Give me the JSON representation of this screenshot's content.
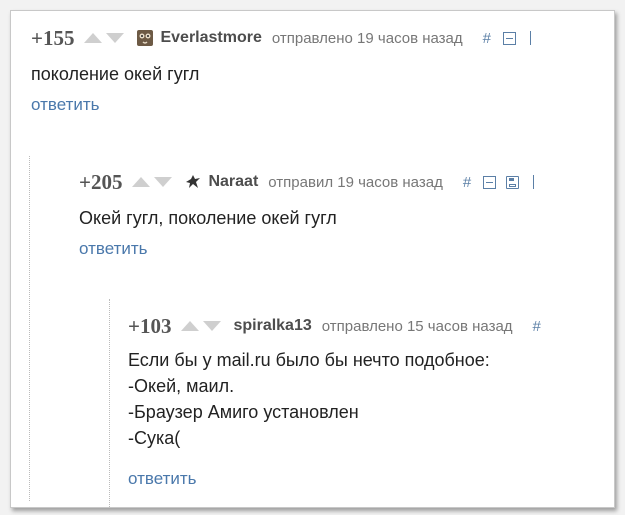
{
  "comments": [
    {
      "rating": "+155",
      "author": "Everlastmore",
      "time": "отправлено 19 часов назад",
      "lines": [
        "поколение окей гугл"
      ],
      "reply": "ответить",
      "avatar_icon": "owl-avatar-icon"
    },
    {
      "rating": "+205",
      "author": "Naraat",
      "time": "отправил 19 часов назад",
      "lines": [
        "Окей гугл, поколение окей гугл"
      ],
      "reply": "ответить",
      "avatar_icon": "bird-avatar-icon"
    },
    {
      "rating": "+103",
      "author": "spiralka13",
      "time": "отправлено 15 часов назад",
      "lines": [
        "Если бы у mail.ru было бы нечто подобное:",
        "-Окей, маил.",
        "-Браузер Амиго установлен",
        "-Сука("
      ],
      "reply": "ответить"
    }
  ],
  "icons": {
    "hash": "#"
  },
  "colors": {
    "link": "#4a78ab",
    "rating": "#555555",
    "vote_arrow": "#cfcfcf"
  }
}
